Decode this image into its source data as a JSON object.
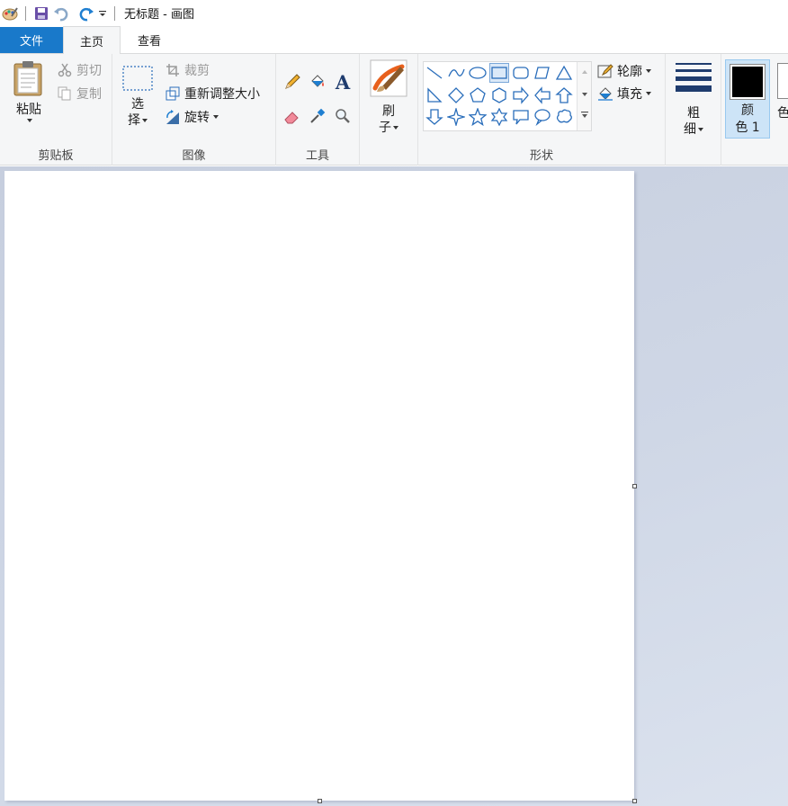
{
  "window": {
    "title": "无标题 - 画图"
  },
  "tabs": {
    "file": "文件",
    "home": "主页",
    "view": "查看"
  },
  "clipboard": {
    "paste_line1": "粘贴",
    "cut": "剪切",
    "copy": "复制",
    "group_label": "剪贴板"
  },
  "image": {
    "select_line1": "选",
    "select_line2": "择",
    "crop": "裁剪",
    "resize": "重新调整大小",
    "rotate": "旋转",
    "group_label": "图像"
  },
  "tools": {
    "group_label": "工具"
  },
  "brushes": {
    "line1": "刷",
    "line2": "子"
  },
  "shapes": {
    "outline": "轮廓",
    "fill": "填充",
    "group_label": "形状"
  },
  "size": {
    "line1": "粗",
    "line2": "细"
  },
  "colors": {
    "color1_line1": "颜",
    "color1_line2": "色 1",
    "color2_line2": "色",
    "color1_value": "#000000",
    "accent": "#1979ca"
  }
}
